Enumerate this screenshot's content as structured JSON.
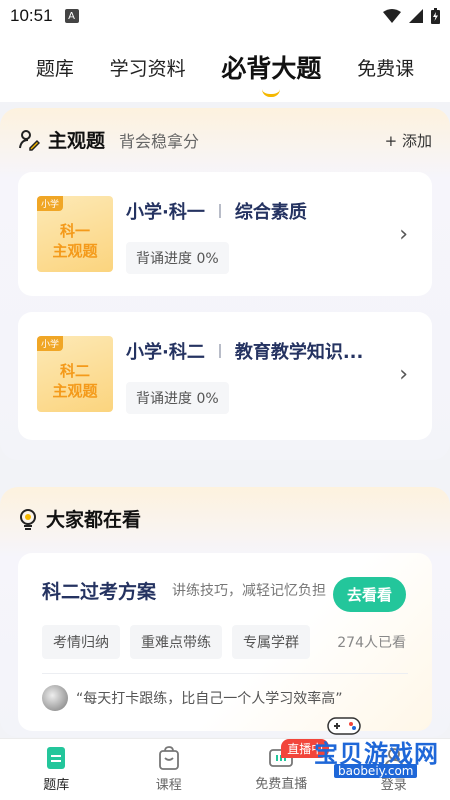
{
  "status_bar": {
    "time": "10:51",
    "notification_letter": "A"
  },
  "top_tabs": [
    {
      "label": "题库",
      "active": false
    },
    {
      "label": "学习资料",
      "active": false
    },
    {
      "label": "必背大题",
      "active": true
    },
    {
      "label": "免费课",
      "active": false
    }
  ],
  "subjective": {
    "title": "主观题",
    "subtitle": "背会稳拿分",
    "add_label": "+ 添加",
    "cards": [
      {
        "tag": "小学",
        "thumb_line1": "科一",
        "thumb_line2": "主观题",
        "subject": "小学·科一",
        "topic": "综合素质",
        "progress": "背诵进度 0%"
      },
      {
        "tag": "小学",
        "thumb_line1": "科二",
        "thumb_line2": "主观题",
        "subject": "小学·科二",
        "topic": "教育教学知识...",
        "progress": "背诵进度 0%"
      }
    ]
  },
  "popular": {
    "title": "大家都在看",
    "plan": {
      "title": "科二过考方案",
      "desc": "讲练技巧，减轻记忆负担",
      "button": "去看看",
      "chips": [
        "考情归纳",
        "重难点带练",
        "专属学群"
      ],
      "viewers": "274人已看",
      "quote": "“每天打卡跟练，比自己一个人学习效率高”"
    }
  },
  "bottom_nav": [
    {
      "label": "题库",
      "active": true
    },
    {
      "label": "课程",
      "active": false
    },
    {
      "label": "免费直播",
      "active": false,
      "badge": "直播中"
    },
    {
      "label": "登录",
      "active": false
    }
  ],
  "watermark": {
    "text": "宝贝游戏网",
    "url": "baobeiy.com"
  },
  "colors": {
    "accent_green": "#23c69b",
    "title_navy": "#253361",
    "thumb_orange": "#f49a1a",
    "live_red": "#f2453b"
  }
}
